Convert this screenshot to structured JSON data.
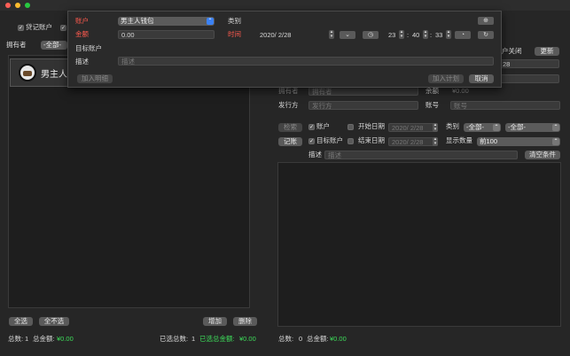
{
  "window": {
    "traffic_lights": [
      "close",
      "minimize",
      "zoom"
    ],
    "colors": {
      "background": "#262626",
      "popover": "#2a2a2a",
      "red": "#ff5a4e",
      "green": "#3ddc5a",
      "accent": "#3b82f6"
    }
  },
  "left": {
    "accounting_checkbox": "贷记账户",
    "owner_label": "拥有者",
    "owner_select": "-全部-",
    "list_items": [
      {
        "name": "男主人钱包",
        "icon": "wallet-avatar-icon"
      }
    ],
    "buttons": {
      "select_all": "全选",
      "select_none": "全不选",
      "add": "增加",
      "delete": "删除"
    },
    "footer": {
      "total_count_label": "总数:",
      "total_count": "1",
      "total_amount_label": "总金额:",
      "total_amount": "¥0.00",
      "selected_count_label": "已选总数:",
      "selected_count": "1",
      "selected_amount_label": "已选总金额:",
      "selected_amount": "¥0.00"
    }
  },
  "right": {
    "account_closed_label": "户关闭",
    "update_button": "更新",
    "date_partial": "28",
    "owner_label": "拥有者",
    "owner_placeholder": "拥有者",
    "balance_label": "余额",
    "balance_value": "¥0.00",
    "issuer_label": "发行方",
    "issuer_placeholder": "发行方",
    "account_no_label": "账号",
    "account_no_placeholder": "账号",
    "search_button": "检索",
    "accounting_button": "记账",
    "account_check": "账户",
    "target_account_check": "目标账户",
    "start_date_label": "开始日期",
    "end_date_label": "结束日期",
    "start_date": "2020/ 2/28",
    "end_date": "2020/ 2/28",
    "category_label": "类别",
    "category_select_1": "-全部-",
    "category_select_2": "-全部-",
    "display_count_label": "显示数量",
    "display_count_select": "前100",
    "desc_label": "描述",
    "desc_placeholder": "描述",
    "clear_button": "清空条件",
    "footer": {
      "total_count_label": "总数:",
      "total_count": "0",
      "total_amount_label": "总金额:",
      "total_amount": "¥0.00"
    }
  },
  "popover": {
    "account_label": "账户",
    "account_select": "男主人钱包",
    "category_label": "类别",
    "category_select_1": "",
    "category_select_2": "",
    "amount_label": "金额",
    "amount_value": "0.00",
    "time_label": "时间",
    "date_value": "2020/ 2/28",
    "hour": "23",
    "minute": "40",
    "second": "33",
    "target_account_label": "目标账户",
    "target_account_select": "",
    "desc_label": "描述",
    "desc_placeholder": "描述",
    "add_detail_button": "加入明细",
    "add_plan_button": "加入计划",
    "cancel_button": "取消"
  }
}
